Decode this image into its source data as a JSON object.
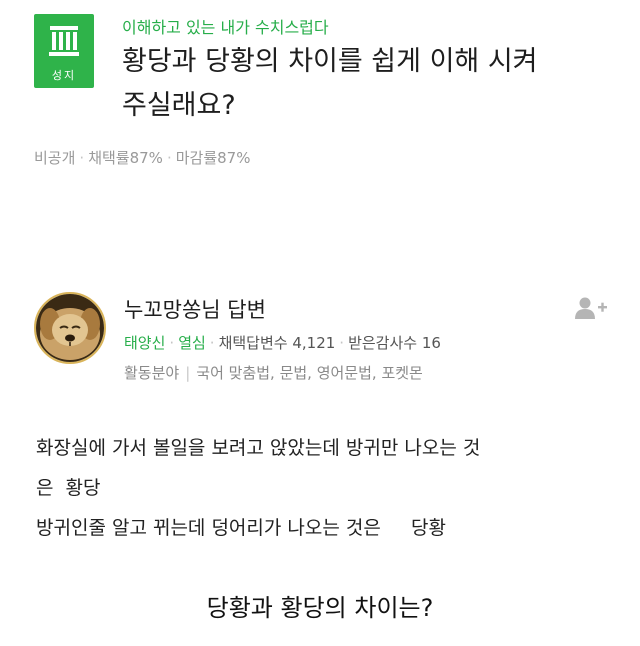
{
  "question": {
    "badge_label": "성지",
    "category_title": "이해하고 있는 내가 수치스럽다",
    "title_line1": "황당과 당황의 차이를 쉽게 이해 시켜",
    "title_line2": "주실래요?",
    "meta": [
      "비공개",
      "채택률87%",
      "마감률87%"
    ]
  },
  "answer": {
    "name": "누꼬망쏭님 답변",
    "grade": "태양신",
    "grade_sub": "열심",
    "adopted_count": "채택답변수 4,121",
    "thanks_count": "받은감사수 16",
    "field_label": "활동분야",
    "field_value": "국어 맞춤법, 문법, 영어문법, 포켓몬",
    "body_lines": [
      "화장실에 가서 볼일을 보려고 앉았는데 방귀만 나오는 것",
      "은  황당",
      "방귀인줄 알고 뀌는데 덩어리가 나오는 것은     당황"
    ]
  },
  "caption": "당황과 황당의 차이는?",
  "colors": {
    "brand_green": "#2fb34a",
    "text_dark": "#1e1e1e",
    "meta_gray": "#9a9a9a"
  },
  "icons": {
    "badge": "pillar-building-icon",
    "avatar": "puppy-avatar",
    "follow": "add-user-icon"
  }
}
